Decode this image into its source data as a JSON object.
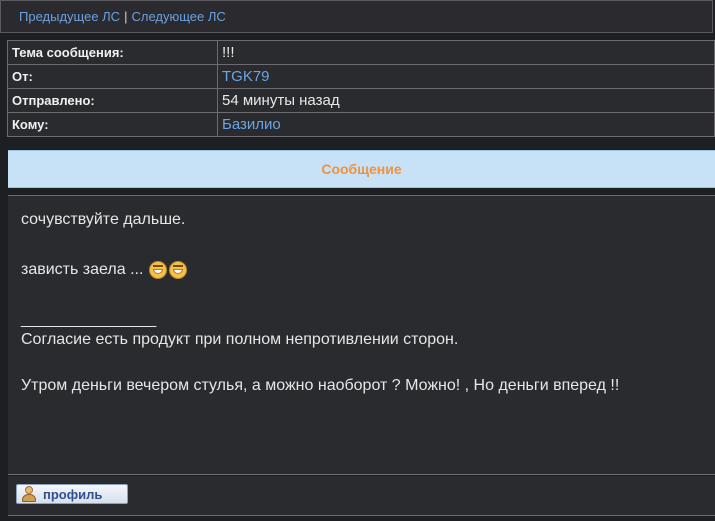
{
  "nav": {
    "prev_label": "Предыдущее ЛС",
    "separator": "|",
    "next_label": "Следующее ЛС"
  },
  "header": {
    "subject_label": "Тема сообщения:",
    "subject_value": "!!!",
    "from_label": "От:",
    "from_value": "TGK79",
    "sent_label": "Отправлено:",
    "sent_value": "54 минуты назад",
    "to_label": "Кому:",
    "to_value": "Базилио"
  },
  "message": {
    "banner": "Сообщение",
    "line1": "сочувствуйте дальше.",
    "line2": "зависть заела ...",
    "smileys": [
      "grin-smiley-icon",
      "grin-smiley-icon"
    ],
    "signature_separator": "_________________",
    "signature_line1": "Согласие есть продукт при полном непротивлении сторон.",
    "signature_line2": "Утром деньги вечером стулья, а можно наоборот ? Можно! , Но деньги вперед !!"
  },
  "footer": {
    "profile_label": "профиль",
    "profile_icon": "user-profile-icon"
  },
  "colors": {
    "background": "#1e1f22",
    "link": "#6aa6e2",
    "banner_bg": "#c7e2f7",
    "banner_text": "#f0923c"
  }
}
